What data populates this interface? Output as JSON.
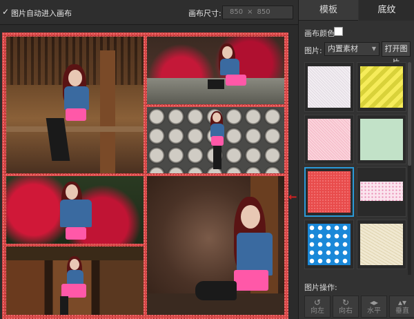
{
  "toolbar": {
    "auto_canvas_label": "图片自动进入画布",
    "auto_canvas_checked": true,
    "canvas_size_label": "画布尺寸:",
    "canvas_width": "850",
    "canvas_separator": "×",
    "canvas_height": "850"
  },
  "panel": {
    "tabs": [
      {
        "label": "模板",
        "active": false
      },
      {
        "label": "底纹",
        "active": true
      }
    ],
    "canvas_color_label": "画布颜色:",
    "canvas_color": "#ffffff",
    "image_label": "图片:",
    "image_source": "内置素材",
    "open_image_button": "打开图片",
    "textures": [
      {
        "name": "white-linen",
        "colors": [
          "#f2eef2",
          "#e2dae2"
        ],
        "selected": false
      },
      {
        "name": "yellow-stripes",
        "colors": [
          "#f6ec5a",
          "#d9d23a"
        ],
        "selected": false
      },
      {
        "name": "pink-linen",
        "colors": [
          "#fbd4dc",
          "#f4b8c6"
        ],
        "selected": false
      },
      {
        "name": "mint",
        "colors": [
          "#c2e2c8",
          "#a8d4b0"
        ],
        "selected": false
      },
      {
        "name": "red-speckle",
        "colors": [
          "#e84c4c",
          "#f27070"
        ],
        "selected": true
      },
      {
        "name": "pink-dots",
        "colors": [
          "#fbe4ee",
          "#e88ab2"
        ],
        "selected": false
      },
      {
        "name": "blue-polka",
        "colors": [
          "#1a88d8",
          "#ffffff"
        ],
        "selected": false
      },
      {
        "name": "beige",
        "colors": [
          "#f0e8d0",
          "#e0d4b0"
        ],
        "selected": false
      }
    ],
    "image_ops_label": "图片操作:",
    "ops": [
      {
        "icon": "rotate-left-icon",
        "glyph": "↺",
        "label": "向左"
      },
      {
        "icon": "rotate-right-icon",
        "glyph": "↻",
        "label": "向右"
      },
      {
        "icon": "flip-horizontal-icon",
        "glyph": "◂▸",
        "label": "水平"
      },
      {
        "icon": "flip-vertical-icon",
        "glyph": "▴▾",
        "label": "垂直"
      }
    ]
  },
  "colors": {
    "accent": "#2a9ad8",
    "annotation_arrow": "#e02020",
    "canvas_texture": "#d84848"
  }
}
